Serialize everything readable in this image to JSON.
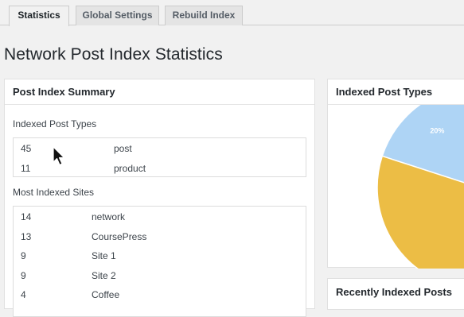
{
  "tabs": [
    {
      "label": "Statistics",
      "active": true
    },
    {
      "label": "Global Settings",
      "active": false
    },
    {
      "label": "Rebuild Index",
      "active": false
    }
  ],
  "page": {
    "title": "Network Post Index Statistics"
  },
  "summary_panel": {
    "title": "Post Index Summary",
    "post_types_label": "Indexed Post Types",
    "post_types": [
      {
        "count": "45",
        "name": "post"
      },
      {
        "count": "11",
        "name": "product"
      }
    ],
    "sites_label": "Most Indexed Sites",
    "sites": [
      {
        "count": "14",
        "name": "network"
      },
      {
        "count": "13",
        "name": "CoursePress"
      },
      {
        "count": "9",
        "name": "Site 1"
      },
      {
        "count": "9",
        "name": "Site 2"
      },
      {
        "count": "4",
        "name": "Coffee"
      }
    ]
  },
  "types_panel": {
    "title": "Indexed Post Types",
    "chart_data": {
      "type": "pie",
      "slices": [
        {
          "value": 20,
          "label": "20%",
          "color": "#aed4f5"
        },
        {
          "value": 80,
          "label": "",
          "color": "#ecbd45"
        }
      ]
    }
  },
  "recent_panel": {
    "title": "Recently Indexed Posts"
  }
}
